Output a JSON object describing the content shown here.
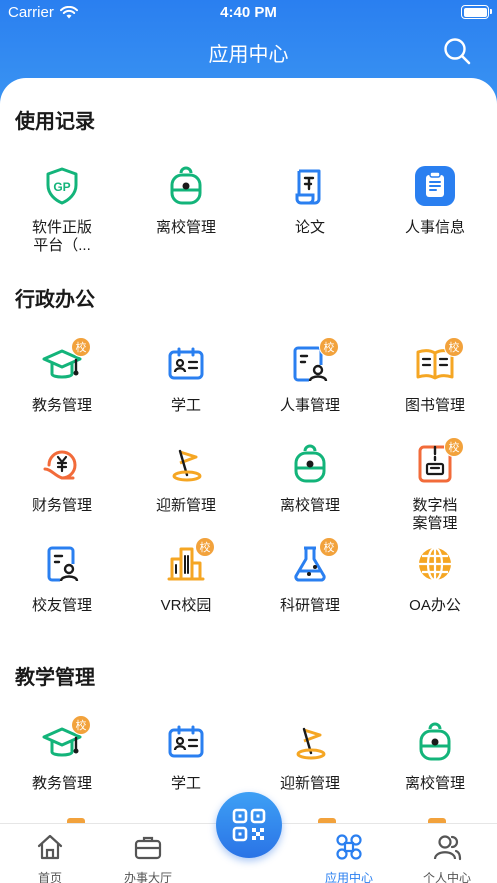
{
  "status_bar": {
    "carrier": "Carrier",
    "time": "4:40 PM"
  },
  "header": {
    "title": "应用中心"
  },
  "badge_text": "校",
  "sections": [
    {
      "title": "使用记录",
      "items": [
        {
          "label": "软件正版\n平台（...",
          "icon": "gp-shield-icon",
          "badge": false
        },
        {
          "label": "离校管理",
          "icon": "backpack-icon",
          "badge": false
        },
        {
          "label": "论文",
          "icon": "paper-scroll-icon",
          "badge": false
        },
        {
          "label": "人事信息",
          "icon": "clipboard-icon",
          "badge": false
        }
      ]
    },
    {
      "title": "行政办公",
      "items": [
        {
          "label": "教务管理",
          "icon": "graduation-cap-icon",
          "badge": true
        },
        {
          "label": "学工",
          "icon": "id-card-icon",
          "badge": false
        },
        {
          "label": "人事管理",
          "icon": "personnel-icon",
          "badge": true
        },
        {
          "label": "图书管理",
          "icon": "book-icon",
          "badge": true
        },
        {
          "label": "财务管理",
          "icon": "finance-icon",
          "badge": false
        },
        {
          "label": "迎新管理",
          "icon": "flag-icon",
          "badge": false
        },
        {
          "label": "离校管理",
          "icon": "backpack-icon",
          "badge": false
        },
        {
          "label": "数字档\n案管理",
          "icon": "archive-icon",
          "badge": true
        },
        {
          "label": "校友管理",
          "icon": "alumni-icon",
          "badge": false
        },
        {
          "label": "VR校园",
          "icon": "buildings-icon",
          "badge": true
        },
        {
          "label": "科研管理",
          "icon": "flask-icon",
          "badge": true
        },
        {
          "label": "OA办公",
          "icon": "globe-icon",
          "badge": false
        }
      ]
    },
    {
      "title": "教学管理",
      "items": [
        {
          "label": "教务管理",
          "icon": "graduation-cap-icon",
          "badge": true
        },
        {
          "label": "学工",
          "icon": "id-card-icon",
          "badge": false
        },
        {
          "label": "迎新管理",
          "icon": "flag-icon",
          "badge": false
        },
        {
          "label": "离校管理",
          "icon": "backpack-icon",
          "badge": false
        }
      ]
    }
  ],
  "tabbar": [
    {
      "label": "首页",
      "icon": "home-icon",
      "active": false
    },
    {
      "label": "办事大厅",
      "icon": "briefcase-icon",
      "active": false
    },
    {
      "label": "应用中心",
      "icon": "apps-icon",
      "active": true
    },
    {
      "label": "个人中心",
      "icon": "person-icon",
      "active": false
    }
  ],
  "colors": {
    "primary": "#2a7ff0",
    "green": "#13b47a",
    "orange": "#f5a623",
    "red": "#f26b3a",
    "badge": "#f2a23c"
  }
}
